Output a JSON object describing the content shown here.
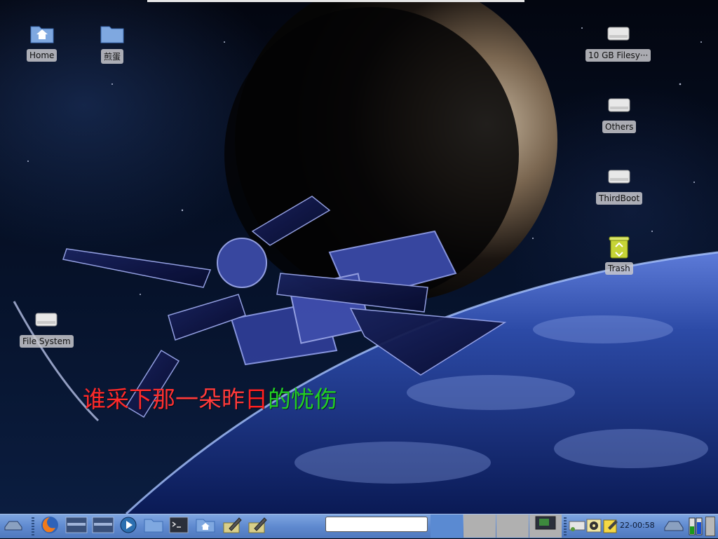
{
  "window_title_strip": "",
  "desktop": {
    "icons": [
      {
        "id": "home",
        "label": "Home",
        "icon": "home-folder-icon"
      },
      {
        "id": "jiandan",
        "label": "煎蛋",
        "icon": "folder-icon"
      },
      {
        "id": "filesystem10gb",
        "label": "10 GB Filesy···",
        "icon": "drive-icon"
      },
      {
        "id": "others",
        "label": "Others",
        "icon": "drive-icon"
      },
      {
        "id": "thirdboot",
        "label": "ThirdBoot",
        "icon": "drive-icon"
      },
      {
        "id": "trash",
        "label": "Trash",
        "icon": "trash-icon"
      },
      {
        "id": "filesystem",
        "label": "File System",
        "icon": "drive-icon"
      }
    ],
    "poem": {
      "chars": [
        {
          "ch": "谁",
          "color": "#ff2a2a"
        },
        {
          "ch": "采",
          "color": "#ff2a2a"
        },
        {
          "ch": "下",
          "color": "#ff2a2a"
        },
        {
          "ch": "那",
          "color": "#ff3030"
        },
        {
          "ch": "一",
          "color": "#ff3a3a"
        },
        {
          "ch": "朵",
          "color": "#ff3a3a"
        },
        {
          "ch": "昨",
          "color": "#ff3a3a"
        },
        {
          "ch": "日",
          "color": "#ff2020"
        },
        {
          "ch": "的",
          "color": "#22d022"
        },
        {
          "ch": "忧",
          "color": "#22d022"
        },
        {
          "ch": "伤",
          "color": "#22d022"
        }
      ]
    }
  },
  "taskbar": {
    "launchers": [
      "menu-icon",
      "firefox-icon",
      "window-switch-icon",
      "window-switch-icon",
      "media-player-icon",
      "file-manager-icon",
      "terminal-icon",
      "home-folder-icon",
      "text-editor-icon",
      "text-editor-icon"
    ],
    "search_value": "",
    "clock": "22-00:58",
    "tray_icons": [
      "network-icon",
      "cd-icon",
      "notes-icon",
      "drive-icon",
      "cpu-monitor-icon"
    ],
    "colors": {
      "active_desktop": "#5a8ad2",
      "inactive_desktop": "#b0b0b0",
      "bar": "#6891d6"
    }
  }
}
